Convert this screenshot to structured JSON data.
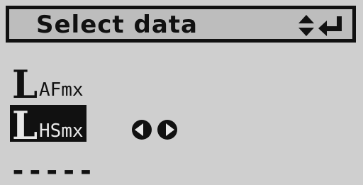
{
  "header": {
    "title": "Select data"
  },
  "icons": {
    "updown": "up-down-arrows-icon",
    "enter": "enter-return-icon",
    "left": "left-arrow-circle-icon",
    "right": "right-arrow-circle-icon"
  },
  "items": [
    {
      "letter": "L",
      "sub": "AFmx",
      "selected": false
    },
    {
      "letter": "L",
      "sub": "HSmx",
      "selected": true
    }
  ],
  "empty_slot": "-----",
  "colors": {
    "screen_bg": "#cfcfcf",
    "ink": "#111111",
    "highlight_text": "#e8e8e8"
  }
}
